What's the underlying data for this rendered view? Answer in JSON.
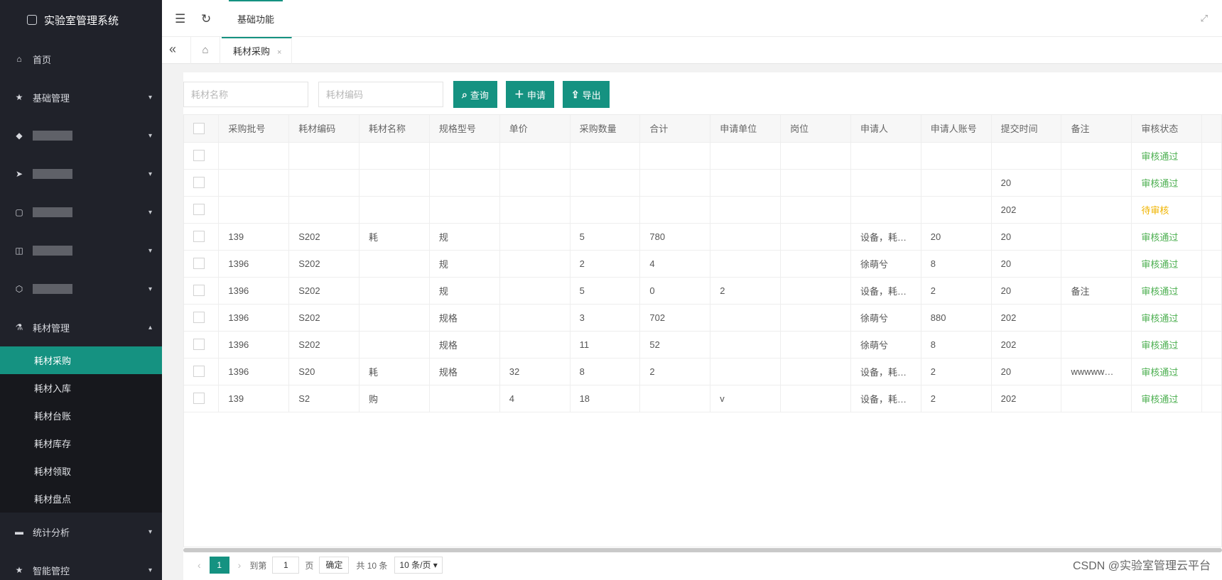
{
  "brand": {
    "title": "实验室管理系统",
    "icon": "cube-icon"
  },
  "sidebar": {
    "items": [
      {
        "label": "首页",
        "icon": "home-icon"
      },
      {
        "label": "基础管理",
        "icon": "star-icon"
      },
      {
        "label": "",
        "icon": "layers-icon"
      },
      {
        "label": "",
        "icon": "send-icon"
      },
      {
        "label": "",
        "icon": "doc-icon"
      },
      {
        "label": "",
        "icon": "book-icon"
      },
      {
        "label": "",
        "icon": "box-icon"
      },
      {
        "label": "耗材管理",
        "icon": "flask-icon"
      }
    ],
    "submenu": [
      "耗材采购",
      "耗材入库",
      "耗材台账",
      "耗材库存",
      "耗材领取",
      "耗材盘点"
    ],
    "bottom": [
      {
        "label": "统计分析",
        "icon": "monitor-icon"
      },
      {
        "label": "智能管控",
        "icon": "star-icon"
      }
    ]
  },
  "topbar": {
    "nav_label": "基础功能"
  },
  "tabs": {
    "active_label": "耗材采购",
    "close": "×"
  },
  "search": {
    "name_placeholder": "耗材名称",
    "code_placeholder": "耗材编码",
    "query_label": "查询",
    "apply_label": "申请",
    "export_label": "导出"
  },
  "table": {
    "headers": [
      "采购批号",
      "耗材编码",
      "耗材名称",
      "规格型号",
      "单价",
      "采购数量",
      "合计",
      "申请单位",
      "岗位",
      "申请人",
      "申请人账号",
      "提交时间",
      "备注",
      "审核状态"
    ],
    "rows": [
      [
        "",
        "",
        "",
        "",
        "",
        "",
        "",
        "",
        "",
        "",
        "",
        "",
        "",
        "审核通过"
      ],
      [
        "",
        "",
        "",
        "",
        "",
        "",
        "",
        "",
        "",
        "",
        "",
        "20",
        "",
        "审核通过"
      ],
      [
        "",
        "",
        "",
        "",
        "",
        "",
        "",
        "",
        "",
        "",
        "",
        "202",
        "",
        "待审核"
      ],
      [
        "139",
        "S202",
        "耗",
        "规",
        "",
        "5",
        "780",
        "",
        "",
        "设备，耗…",
        "20",
        "20",
        "",
        "审核通过"
      ],
      [
        "1396",
        "S202",
        "",
        "规",
        "",
        "2",
        "4",
        "",
        "",
        "徐萌兮",
        "8",
        "20",
        "",
        "审核通过"
      ],
      [
        "1396",
        "S202",
        "",
        "规",
        "",
        "5",
        "0",
        "2",
        "",
        "设备，耗…",
        "2",
        "20",
        "备注",
        "审核通过"
      ],
      [
        "1396",
        "S202",
        "",
        "规格",
        "",
        "3",
        "702",
        "",
        "",
        "徐萌兮",
        "880",
        "202",
        "",
        "审核通过"
      ],
      [
        "1396",
        "S202",
        "",
        "规格",
        "",
        "11",
        "52",
        "",
        "",
        "徐萌兮",
        "8",
        "202",
        "",
        "审核通过"
      ],
      [
        "1396",
        "S20",
        "耗",
        "规格",
        "32",
        "8",
        "2",
        "",
        "",
        "设备，耗…",
        "2",
        "20",
        "wwwww…",
        "审核通过"
      ],
      [
        "139",
        "S2",
        "购",
        "",
        "4",
        "18",
        "",
        "v",
        "",
        "设备，耗…",
        "2",
        "202",
        "",
        "审核通过"
      ]
    ]
  },
  "pager": {
    "prev": "‹",
    "current": "1",
    "next": "›",
    "goto_label": "到第",
    "goto_value": "1",
    "page_unit": "页",
    "confirm": "确定",
    "total": "共 10 条",
    "page_size": "10 条/页"
  },
  "watermark": "CSDN @实验室管理云平台",
  "colors": {
    "accent": "#159281",
    "sidebar": "#20222a",
    "ok": "#4caf50",
    "pending": "#f0b400"
  }
}
